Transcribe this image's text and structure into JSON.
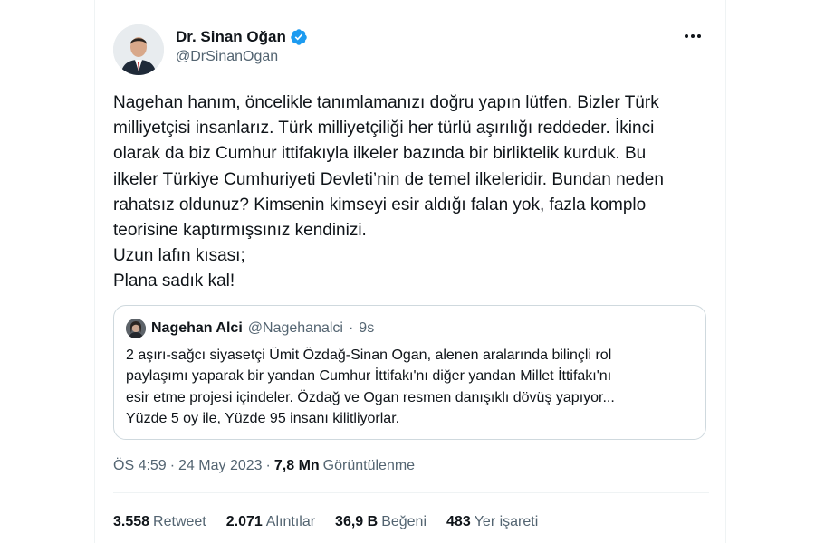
{
  "author": {
    "name": "Dr. Sinan Oğan",
    "handle": "@DrSinanOgan",
    "verified": true,
    "verified_color": "#1d9bf0"
  },
  "tweet": {
    "lines": [
      "Nagehan hanım, öncelikle tanımlamanızı doğru yapın lütfen. Bizler Türk",
      "milliyetçisi insanlarız. Türk milliyetçiliği her türlü aşırılığı reddeder. İkinci",
      "olarak da biz Cumhur ittifakıyla ilkeler bazında bir birliktelik kurduk. Bu",
      "ilkeler Türkiye Cumhuriyeti Devleti’nin de temel ilkeleridir. Bundan neden",
      "rahatsız oldunuz?  Kimsenin kimseyi esir aldığı falan yok, fazla komplo",
      "teorisine kaptırmışsınız kendinizi.",
      "Uzun lafın kısası;",
      "Plana sadık kal!"
    ]
  },
  "quote": {
    "name": "Nagehan Alci",
    "handle": "@Nagehanalci",
    "separator": "·",
    "time": "9s",
    "lines": [
      "2 aşırı-sağcı siyasetçi Ümit Özdağ-Sinan Ogan, alenen aralarında bilinçli rol",
      "paylaşımı yaparak bir yandan Cumhur İttifakı'nı diğer yandan Millet İttifakı'nı",
      "esir etme projesi içindeler. Özdağ ve Ogan resmen danışıklı dövüş yapıyor...",
      "Yüzde 5 oy ile, Yüzde 95 insanı kilitliyorlar."
    ]
  },
  "meta": {
    "time": "ÖS 4:59",
    "separator1": "·",
    "date": "24 May 2023",
    "separator2": "·",
    "views_count": "7,8 Mn",
    "views_label": "Görüntülenme"
  },
  "stats": [
    {
      "num": "3.558",
      "label": "Retweet"
    },
    {
      "num": "2.071",
      "label": "Alıntılar"
    },
    {
      "num": "36,9 B",
      "label": "Beğeni"
    },
    {
      "num": "483",
      "label": "Yer işareti"
    }
  ],
  "icons": {
    "more": "more-horizontal-icon",
    "verified": "verified-badge-icon"
  }
}
